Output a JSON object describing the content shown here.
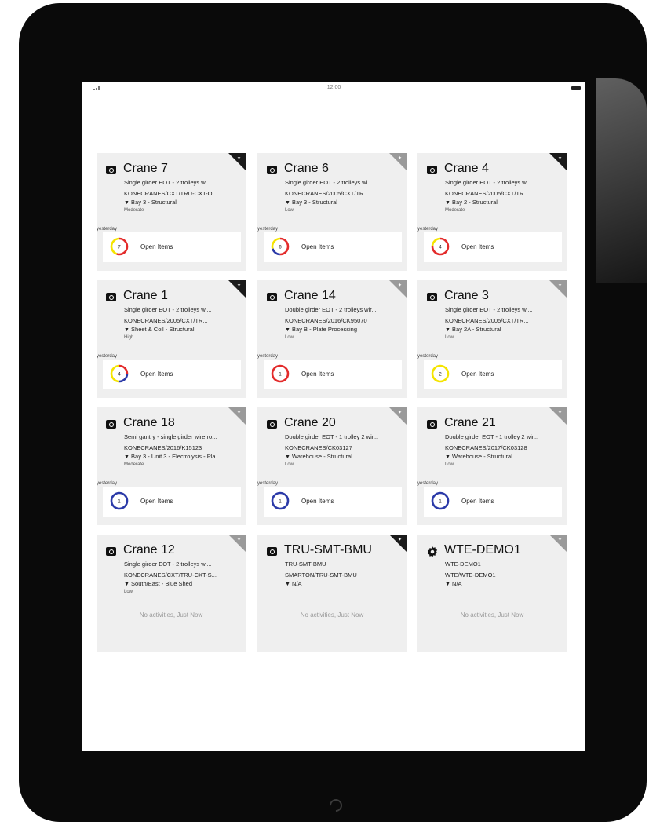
{
  "status_bar": {
    "time": "12:00"
  },
  "labels": {
    "open_items": "Open Items",
    "yesterday": "yesterday"
  },
  "cards": [
    {
      "title": "Crane 7",
      "desc": "Single girder EOT - 2 trolleys wi...",
      "code": "KONECRANES/CXT/TRU-CXT-O...",
      "location": "Bay 3 - Structural",
      "priority": "Moderate",
      "count": "7",
      "flag": "dark",
      "icon": "camera-icon",
      "segments": [
        {
          "color": "#e32b2b",
          "frac": 0.55
        },
        {
          "color": "#f5e400",
          "frac": 0.45
        }
      ]
    },
    {
      "title": "Crane 6",
      "desc": "Single girder EOT - 2 trolleys wi...",
      "code": "KONECRANES/2005/CXT/TR...",
      "location": "Bay 3 - Structural",
      "priority": "Low",
      "count": "6",
      "flag": "light",
      "icon": "camera-icon",
      "segments": [
        {
          "color": "#e32b2b",
          "frac": 0.5
        },
        {
          "color": "#2b3aa8",
          "frac": 0.2
        },
        {
          "color": "#f5e400",
          "frac": 0.3
        }
      ]
    },
    {
      "title": "Crane 4",
      "desc": "Single girder EOT - 2 trolleys wi...",
      "code": "KONECRANES/2005/CXT/TR...",
      "location": "Bay 2 - Structural",
      "priority": "Moderate",
      "count": "4",
      "flag": "dark",
      "icon": "camera-icon",
      "segments": [
        {
          "color": "#e32b2b",
          "frac": 0.75
        },
        {
          "color": "#f5e400",
          "frac": 0.25
        }
      ]
    },
    {
      "title": "Crane 1",
      "desc": "Single girder EOT - 2 trolleys wi...",
      "code": "KONECRANES/2005/CXT/TR...",
      "location": "Sheet & Coil - Structural",
      "priority": "High",
      "count": "4",
      "flag": "dark",
      "icon": "camera-icon",
      "segments": [
        {
          "color": "#e32b2b",
          "frac": 0.25
        },
        {
          "color": "#2b3aa8",
          "frac": 0.25
        },
        {
          "color": "#f5e400",
          "frac": 0.5
        }
      ]
    },
    {
      "title": "Crane 14",
      "desc": "Double girder EOT - 2 trolleys wir...",
      "code": "KONECRANES/2016/CK95070",
      "location": "Bay B - Plate Processing",
      "priority": "Low",
      "count": "1",
      "flag": "light",
      "icon": "camera-icon",
      "segments": [
        {
          "color": "#e32b2b",
          "frac": 1
        }
      ]
    },
    {
      "title": "Crane 3",
      "desc": "Single girder EOT - 2 trolleys wi...",
      "code": "KONECRANES/2005/CXT/TR...",
      "location": "Bay 2A - Structural",
      "priority": "Low",
      "count": "2",
      "flag": "light",
      "icon": "camera-icon",
      "segments": [
        {
          "color": "#f5e400",
          "frac": 1
        }
      ]
    },
    {
      "title": "Crane 18",
      "desc": "Semi gantry - single girder wire ro...",
      "code": "KONECRANES/2016/K15123",
      "location": "Bay 3 - Unit 3 - Electrolysis - Pla...",
      "priority": "Moderate",
      "count": "1",
      "flag": "light",
      "icon": "camera-icon",
      "segments": [
        {
          "color": "#2b3aa8",
          "frac": 1
        }
      ]
    },
    {
      "title": "Crane 20",
      "desc": "Double girder EOT - 1 trolley 2 wir...",
      "code": "KONECRANES/CK03127",
      "location": "Warehouse - Structural",
      "priority": "Low",
      "count": "1",
      "flag": "light",
      "icon": "camera-icon",
      "segments": [
        {
          "color": "#2b3aa8",
          "frac": 1
        }
      ]
    },
    {
      "title": "Crane 21",
      "desc": "Double girder EOT - 1 trolley 2 wir...",
      "code": "KONECRANES/2017/CK03128",
      "location": "Warehouse - Structural",
      "priority": "Low",
      "count": "1",
      "flag": "light",
      "icon": "camera-icon",
      "segments": [
        {
          "color": "#2b3aa8",
          "frac": 1
        }
      ]
    },
    {
      "title": "Crane 12",
      "desc": "Single girder EOT - 2 trolleys wi...",
      "code": "KONECRANES/CXT/TRU-CXT-S...",
      "location": "South/East - Blue Shed",
      "priority": "Low",
      "activity": "No activities, Just Now",
      "flag": "light",
      "icon": "camera-icon"
    },
    {
      "title": "TRU-SMT-BMU",
      "desc": "TRU-SMT-BMU",
      "code": "SMARTON/TRU-SMT-BMU",
      "location": "N/A",
      "priority": "",
      "activity": "No activities, Just Now",
      "flag": "dark",
      "icon": "camera-icon"
    },
    {
      "title": "WTE-DEMO1",
      "desc": "WTE-DEMO1",
      "code": "WTE/WTE-DEMO1",
      "location": "N/A",
      "priority": "",
      "activity": "No activities, Just Now",
      "flag": "light",
      "icon": "gear-icon"
    }
  ]
}
